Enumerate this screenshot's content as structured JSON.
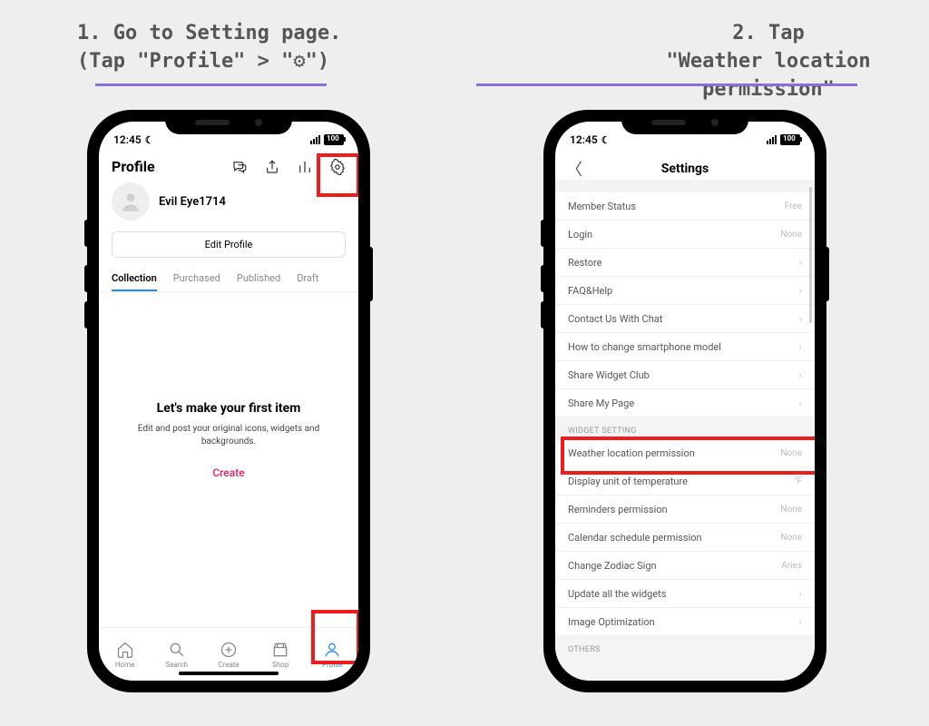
{
  "instructions": {
    "step1_line1": "1. Go to Setting page.",
    "step1_line2": "(Tap \"Profile\" > \"⚙\")",
    "step2_line1": "2. Tap",
    "step2_line2": "\"Weather location permission\""
  },
  "status": {
    "time": "12:45",
    "battery_label": "100"
  },
  "profile": {
    "header_title": "Profile",
    "username": "Evil Eye1714",
    "edit_button": "Edit Profile",
    "tabs": {
      "collection": "Collection",
      "purchased": "Purchased",
      "published": "Published",
      "draft": "Draft"
    },
    "empty_title": "Let's make your first item",
    "empty_body": "Edit and post your original icons, widgets and backgrounds.",
    "create": "Create",
    "nav": {
      "home": "Home",
      "search": "Search",
      "create": "Create",
      "shop": "Shop",
      "profile": "Profile"
    }
  },
  "settings": {
    "title": "Settings",
    "section_widget": "WIDGET SETTING",
    "section_others": "OTHERS",
    "rows": {
      "member_status": {
        "label": "Member Status",
        "value": "Free"
      },
      "login": {
        "label": "Login",
        "value": "None"
      },
      "restore": {
        "label": "Restore"
      },
      "faq": {
        "label": "FAQ&Help"
      },
      "contact": {
        "label": "Contact Us With Chat"
      },
      "change_model": {
        "label": "How to change smartphone model"
      },
      "share_club": {
        "label": "Share Widget Club"
      },
      "share_page": {
        "label": "Share My Page"
      },
      "weather": {
        "label": "Weather location permission",
        "value": "None"
      },
      "temp_unit": {
        "label": "Display unit of temperature",
        "value": "°F"
      },
      "reminders": {
        "label": "Reminders permission",
        "value": "None"
      },
      "calendar": {
        "label": "Calendar schedule permission",
        "value": "None"
      },
      "zodiac": {
        "label": "Change Zodiac Sign",
        "value": "Aries"
      },
      "update_widgets": {
        "label": "Update all the widgets"
      },
      "image_opt": {
        "label": "Image Optimization"
      }
    }
  }
}
